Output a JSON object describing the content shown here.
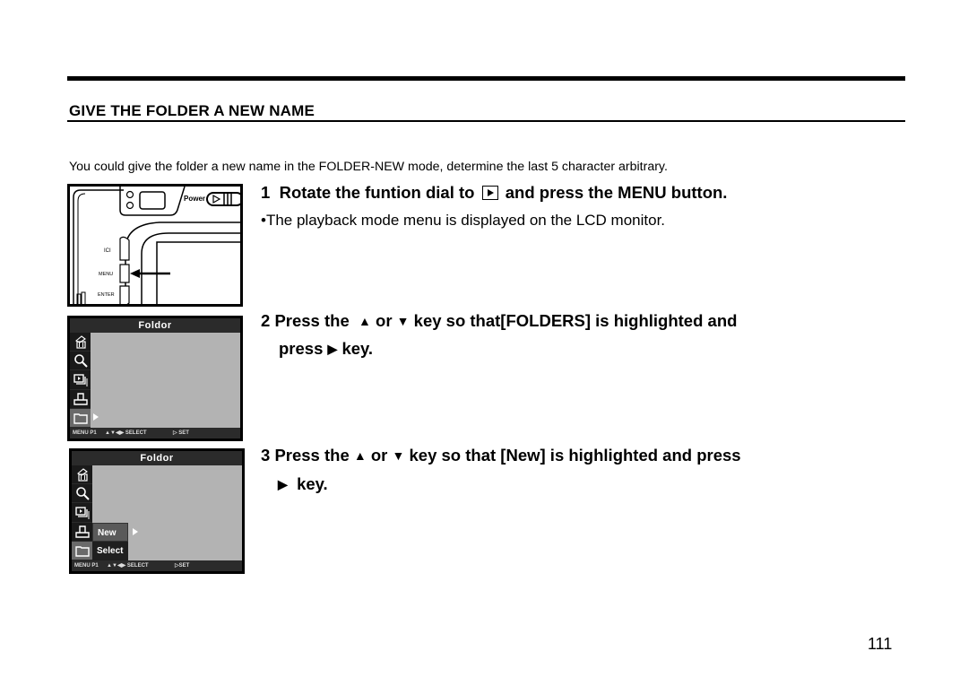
{
  "section": {
    "title": "GIVE THE FOLDER A NEW NAME",
    "intro": "You could give the folder a new name in the FOLDER-NEW mode, determine the last 5 character arbitrary."
  },
  "steps": [
    {
      "number": "1",
      "text_before_icon": "Rotate the funtion dial to",
      "icon": "playback-mode-icon",
      "text_after_icon": "and press the MENU button.",
      "note": "•The playback mode menu is displayed on the LCD monitor."
    },
    {
      "number": "2",
      "line1_a": "Press the",
      "up_glyph": "▲",
      "line1_b": "or",
      "down_glyph": "▼",
      "line1_c": "key so that[FOLDERS] is highlighted and",
      "line2_a": "press",
      "right_glyph": "▶",
      "line2_b": "key."
    },
    {
      "number": "3",
      "line1_a": "Press the",
      "up_glyph": "▲",
      "line1_b": "or",
      "down_glyph": "▼",
      "line1_c": "key so that [New] is highlighted and press",
      "right_glyph": "▶",
      "line2_b": "key."
    }
  ],
  "camera_illustration": {
    "power_label": "Power",
    "buttons": [
      "ICI",
      "MENU",
      "ENTER"
    ],
    "pointed_button": "MENU"
  },
  "lcd_screens": [
    {
      "title": "Foldor",
      "icons": [
        "delete-icon",
        "magnify-icon",
        "slideshow-icon",
        "print-icon",
        "folder-icon"
      ],
      "active_icon": "folder-icon",
      "footer": [
        "MENU P1",
        "▲▼",
        "◀▶ SELECT",
        "▷ SET"
      ]
    },
    {
      "title": "Foldor",
      "icons": [
        "delete-icon",
        "magnify-icon",
        "slideshow-icon",
        "print-icon",
        "folder-icon"
      ],
      "active_icon": "folder-icon",
      "submenu": [
        "New",
        "Select"
      ],
      "highlighted": "New",
      "footer": [
        "MENU P1",
        "▲▼",
        "◀▶ SELECT",
        "▷SET"
      ]
    }
  ],
  "page_number": "111"
}
